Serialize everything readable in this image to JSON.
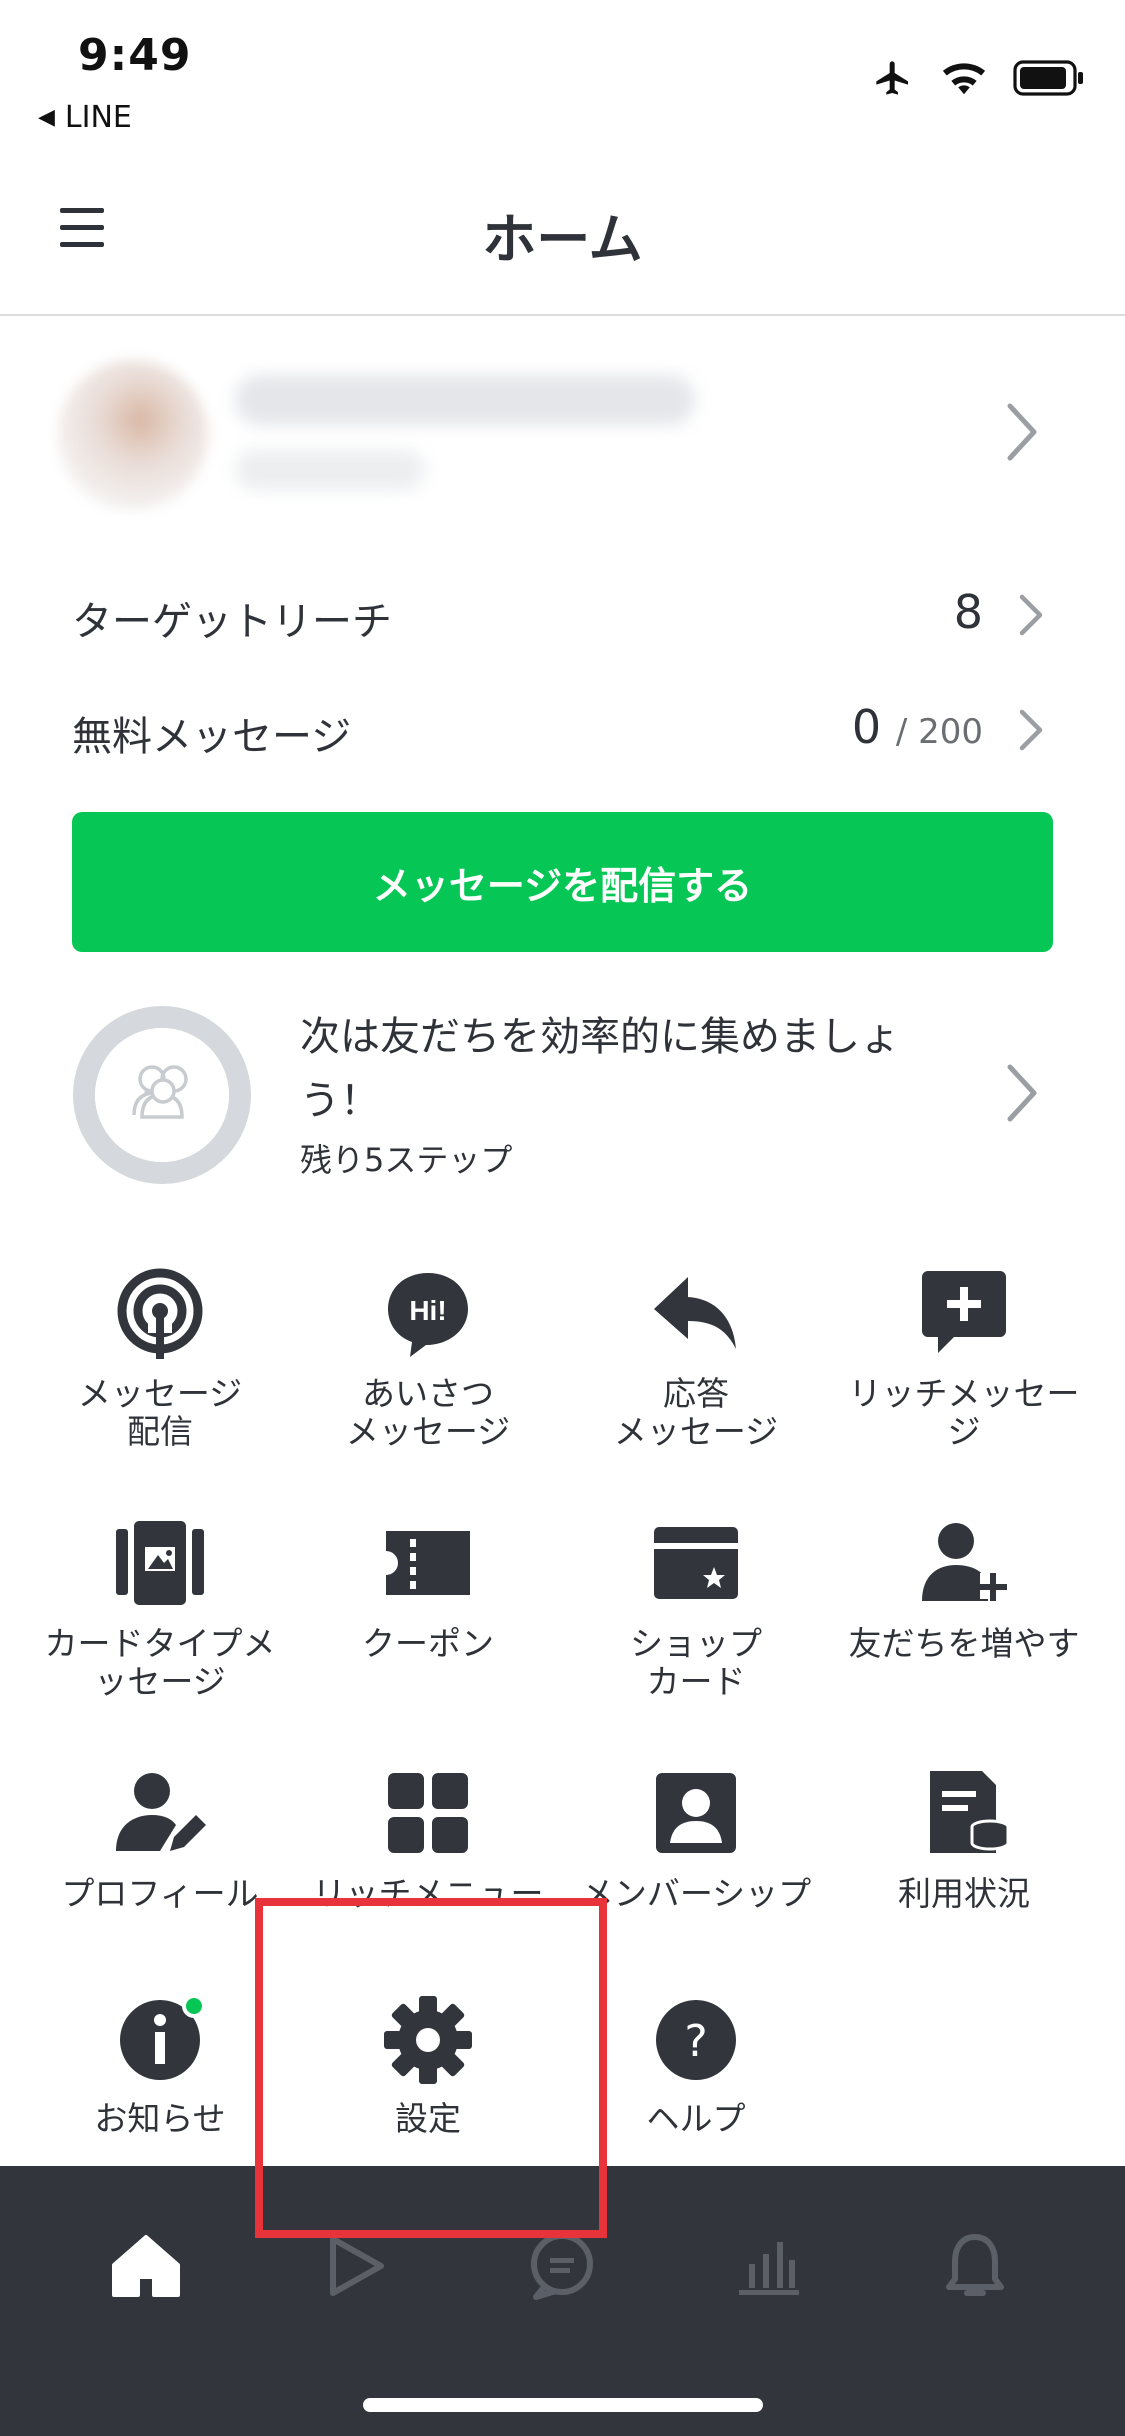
{
  "status_bar": {
    "time": "9:49",
    "back_app": "LINE"
  },
  "header": {
    "title": "ホーム"
  },
  "stats": {
    "target_reach_label": "ターゲットリーチ",
    "target_reach_value": "8",
    "free_message_label": "無料メッセージ",
    "free_message_used": "0",
    "free_message_limit": "/ 200"
  },
  "primary_action": {
    "label": "メッセージを配信する"
  },
  "onboarding": {
    "title": "次は友だちを効率的に集めましょう！",
    "subtitle": "残り5ステップ",
    "progress": 0
  },
  "menu": {
    "items": [
      {
        "label": "メッセージ\n配信",
        "icon": "broadcast-icon"
      },
      {
        "label": "あいさつ\nメッセージ",
        "icon": "greeting-hi-icon"
      },
      {
        "label": "応答\nメッセージ",
        "icon": "reply-arrow-icon"
      },
      {
        "label": "リッチメッセー\nジ",
        "icon": "rich-message-plus-icon"
      },
      {
        "label": "カードタイプメ\nッセージ",
        "icon": "card-type-message-icon"
      },
      {
        "label": "クーポン",
        "icon": "coupon-icon"
      },
      {
        "label": "ショップ\nカード",
        "icon": "shop-card-icon"
      },
      {
        "label": "友だちを増やす",
        "icon": "add-friend-icon"
      },
      {
        "label": "プロフィール",
        "icon": "profile-edit-icon"
      },
      {
        "label": "リッチメニュー",
        "icon": "rich-menu-grid-icon"
      },
      {
        "label": "メンバーシップ",
        "icon": "membership-icon"
      },
      {
        "label": "利用状況",
        "icon": "usage-document-icon"
      },
      {
        "label": "お知らせ",
        "icon": "info-icon"
      },
      {
        "label": "設定",
        "icon": "gear-icon"
      },
      {
        "label": "ヘルプ",
        "icon": "help-icon"
      }
    ]
  },
  "tab_bar": {
    "tabs": [
      {
        "name": "home",
        "icon": "home-icon",
        "active": true
      },
      {
        "name": "timeline",
        "icon": "play-icon",
        "active": false
      },
      {
        "name": "chat",
        "icon": "chat-bubble-icon",
        "active": false
      },
      {
        "name": "analytics",
        "icon": "bar-chart-icon",
        "active": false
      },
      {
        "name": "notifications",
        "icon": "bell-icon",
        "active": false
      }
    ]
  },
  "colors": {
    "accent_green": "#06c755",
    "icon_dark": "#32363c",
    "tab_bar_bg": "#32363c",
    "highlight_red": "#e8333a",
    "notification_dot": "#06c755"
  }
}
